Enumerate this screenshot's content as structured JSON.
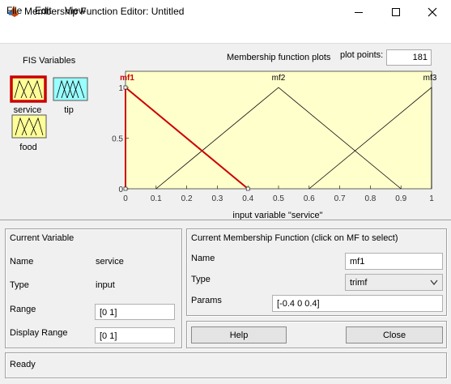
{
  "window": {
    "title": "Membership Function Editor: Untitled",
    "controls": {
      "minimize": "minimize",
      "maximize": "maximize",
      "close": "close"
    }
  },
  "menu": [
    "File",
    "Edit",
    "View"
  ],
  "fis": {
    "heading": "FIS Variables",
    "variables": [
      {
        "name": "service",
        "kind": "input",
        "color": "#ffff99",
        "selected": true
      },
      {
        "name": "tip",
        "kind": "output",
        "color": "#99ffff",
        "selected": false
      },
      {
        "name": "food",
        "kind": "input",
        "color": "#ffff99",
        "selected": false
      }
    ]
  },
  "plot": {
    "title": "Membership function plots",
    "points_label": "plot points:",
    "points_value": "181",
    "background": "#ffffcc",
    "selected_color": "#cc0000",
    "xlabel": "input variable \"service\"",
    "xticks": [
      "0",
      "0.1",
      "0.2",
      "0.3",
      "0.4",
      "0.5",
      "0.6",
      "0.7",
      "0.8",
      "0.9",
      "1"
    ],
    "yticks": [
      "0",
      "0.5",
      "1"
    ]
  },
  "chart_data": {
    "type": "line",
    "xlabel": "input variable \"service\"",
    "xlim": [
      0,
      1
    ],
    "ylim": [
      0,
      1
    ],
    "series": [
      {
        "name": "mf1",
        "x": [
          0,
          0,
          0.4
        ],
        "y": [
          0,
          1,
          0
        ],
        "params": [
          -0.4,
          0,
          0.4
        ],
        "selected": true
      },
      {
        "name": "mf2",
        "x": [
          0.1,
          0.5,
          0.9
        ],
        "y": [
          0,
          1,
          0
        ],
        "params": [
          0.1,
          0.5,
          0.9
        ],
        "selected": false
      },
      {
        "name": "mf3",
        "x": [
          0.6,
          1,
          1
        ],
        "y": [
          0,
          1,
          0
        ],
        "params": [
          0.6,
          1,
          1.4
        ],
        "selected": false
      }
    ]
  },
  "current_variable": {
    "heading": "Current Variable",
    "name_label": "Name",
    "name_value": "service",
    "type_label": "Type",
    "type_value": "input",
    "range_label": "Range",
    "range_value": "[0 1]",
    "display_range_label": "Display Range",
    "display_range_value": "[0 1]"
  },
  "current_mf": {
    "heading": "Current Membership Function (click on MF to select)",
    "name_label": "Name",
    "name_value": "mf1",
    "type_label": "Type",
    "type_value": "trimf",
    "params_label": "Params",
    "params_value": "[-0.4 0 0.4]"
  },
  "buttons": {
    "help": "Help",
    "close": "Close"
  },
  "status": "Ready"
}
